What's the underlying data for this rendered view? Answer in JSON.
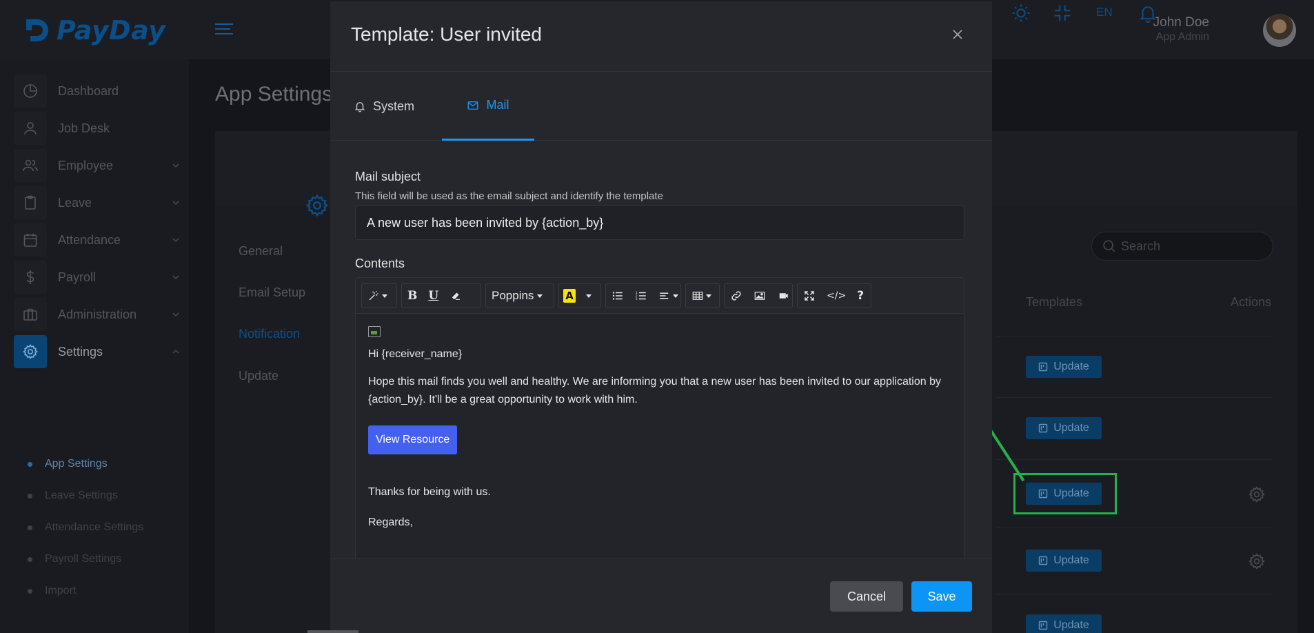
{
  "app": {
    "brand": "PayDay",
    "language": "EN",
    "user": {
      "name": "John Doe",
      "role": "App Admin"
    }
  },
  "sidebar": {
    "items": [
      {
        "label": "Dashboard",
        "icon": "dashboard-icon"
      },
      {
        "label": "Job Desk",
        "icon": "user-icon"
      },
      {
        "label": "Employee",
        "icon": "users-icon"
      },
      {
        "label": "Leave",
        "icon": "clipboard-icon"
      },
      {
        "label": "Attendance",
        "icon": "calendar-icon"
      },
      {
        "label": "Payroll",
        "icon": "dollar-icon"
      },
      {
        "label": "Administration",
        "icon": "briefcase-icon"
      },
      {
        "label": "Settings",
        "icon": "gear-icon"
      }
    ],
    "settings_sub": [
      "App Settings",
      "Leave Settings",
      "Attendance Settings",
      "Payroll Settings",
      "Import"
    ]
  },
  "page": {
    "title": "App Settings",
    "settings_nav": [
      "General",
      "Email Setup",
      "Notification",
      "Update"
    ],
    "search_placeholder": "Search",
    "columns": {
      "templates": "Templates",
      "actions": "Actions"
    },
    "update_label": "Update"
  },
  "modal": {
    "title": "Template: User invited",
    "tabs": {
      "system": "System",
      "mail": "Mail"
    },
    "subject_label": "Mail subject",
    "subject_help": "This field will be used as the email subject and identify the template",
    "subject_value": "A new user has been invited by {action_by}",
    "contents_label": "Contents",
    "toolbar": {
      "font": "Poppins",
      "help": "?"
    },
    "body": {
      "greeting": "Hi {receiver_name}",
      "paragraph": "Hope this mail finds you well and healthy. We are informing you that a new user has been invited to our application by {action_by}. It'll be a great opportunity to work with him.",
      "button": "View Resource",
      "thanks": "Thanks for being with us.",
      "regards": "Regards,"
    },
    "cancel_label": "Cancel",
    "save_label": "Save"
  },
  "colors": {
    "accent": "#2196f3",
    "save": "#0d95f5",
    "view_button": "#4361ee",
    "highlight_box": "#22b24c"
  }
}
